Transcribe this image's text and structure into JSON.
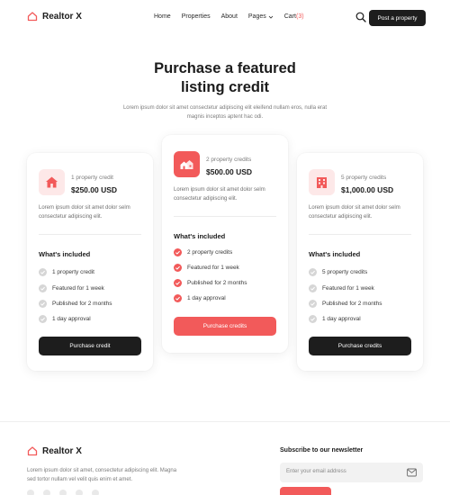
{
  "brand": {
    "name": "Realtor X",
    "accent": "#f25a5a",
    "dark": "#1d1d1d"
  },
  "nav": {
    "items": [
      "Home",
      "Properties",
      "About",
      "Pages"
    ],
    "cart_label": "Cart",
    "cart_count": "(3)",
    "post_label": "Post a property"
  },
  "hero": {
    "title_line1": "Purchase a featured",
    "title_line2": "listing credit",
    "subtitle": "Lorem ipsum dolor sit amet consectetur adipiscing elit eleifend nullam eros, nulla erat magnis inceptos aptent hac odi."
  },
  "plans": [
    {
      "icon": "house-icon",
      "meta": "1 property credit",
      "price": "$250.00 USD",
      "desc": "Lorem ipsum dolor sit amet dolor selm consectetur adipiscing elit.",
      "included_title": "What's included",
      "features": [
        "1 property credit",
        "Featured for 1 week",
        "Published for 2 months",
        "1 day approval"
      ],
      "button": "Purchase credit"
    },
    {
      "icon": "houses-icon",
      "meta": "2 property credits",
      "price": "$500.00 USD",
      "desc": "Lorem ipsum dolor sit amet dolor selm consectetur adipiscing elit.",
      "included_title": "What's included",
      "features": [
        "2 property credits",
        "Featured for 1 week",
        "Published for 2 months",
        "1 day approval"
      ],
      "button": "Purchase credits"
    },
    {
      "icon": "building-icon",
      "meta": "5 property credits",
      "price": "$1,000.00 USD",
      "desc": "Lorem ipsum dolor sit amet dolor selm consectetur adipiscing elit.",
      "included_title": "What's included",
      "features": [
        "5 property credits",
        "Featured for 1 week",
        "Published for 2 months",
        "1 day approval"
      ],
      "button": "Purchase credits"
    }
  ],
  "footer": {
    "brand": "Realtor X",
    "desc": "Lorem ipsum dolor sit amet, consectetur adipiscing elit. Magna sed tortor nullam vel velit quis enim et amet.",
    "newsletter_title": "Subscribe to our newsletter",
    "email_placeholder": "Enter your email address"
  }
}
